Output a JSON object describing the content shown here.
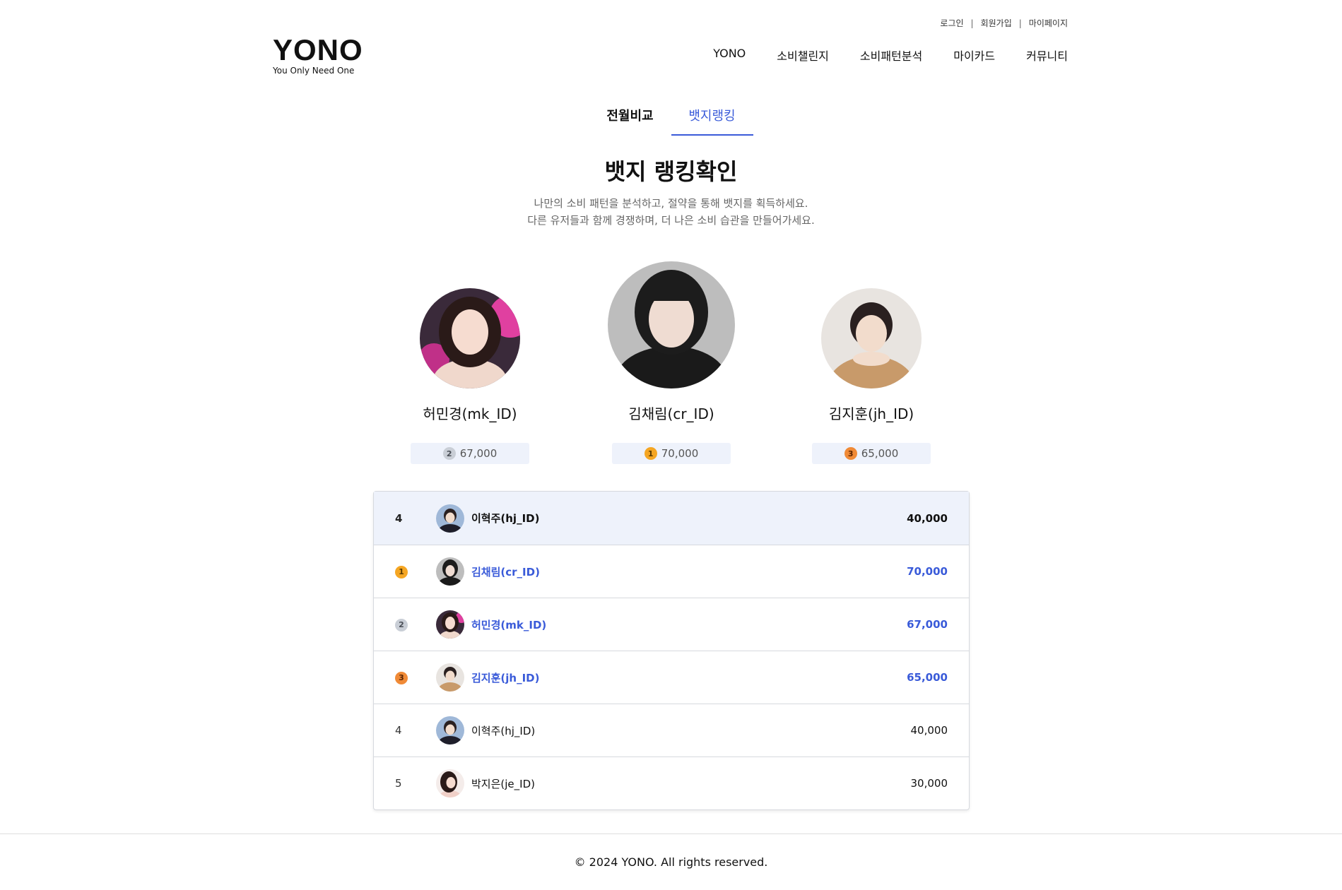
{
  "util": {
    "login": "로그인",
    "signup": "회원가입",
    "mypage": "마이페이지",
    "sep": "|"
  },
  "logo": {
    "title": "YONO",
    "tagline": "You Only Need One"
  },
  "nav": [
    "YONO",
    "소비챌린지",
    "소비패턴분석",
    "마이카드",
    "커뮤니티"
  ],
  "tabs": {
    "compare": "전월비교",
    "ranking": "뱃지랭킹"
  },
  "page": {
    "title": "뱃지 랭킹확인",
    "desc1": "나만의 소비 패턴을 분석하고, 절약을 통해 뱃지를 획득하세요.",
    "desc2": "다른 유저들과 함께 경쟁하며, 더 나은 소비 습관을 만들어가세요."
  },
  "podium": {
    "second": {
      "name": "허민경(mk_ID)",
      "rank": "2",
      "score": "67,000"
    },
    "first": {
      "name": "김채림(cr_ID)",
      "rank": "1",
      "score": "70,000"
    },
    "third": {
      "name": "김지훈(jh_ID)",
      "rank": "3",
      "score": "65,000"
    }
  },
  "table": [
    {
      "rank": "4",
      "name": "이혁주(hj_ID)",
      "score": "40,000"
    },
    {
      "rank": "1",
      "name": "김채림(cr_ID)",
      "score": "70,000"
    },
    {
      "rank": "2",
      "name": "허민경(mk_ID)",
      "score": "67,000"
    },
    {
      "rank": "3",
      "name": "김지훈(jh_ID)",
      "score": "65,000"
    },
    {
      "rank": "4",
      "name": "이혁주(hj_ID)",
      "score": "40,000"
    },
    {
      "rank": "5",
      "name": "박지은(je_ID)",
      "score": "30,000"
    }
  ],
  "footer": {
    "copyright": "© 2024 YONO. All rights reserved."
  },
  "colors": {
    "accent": "#3a5bd9",
    "highlight_bg": "#eef2fb",
    "gold": "#f5a623",
    "silver": "#c9ced6",
    "bronze": "#f08a36"
  }
}
